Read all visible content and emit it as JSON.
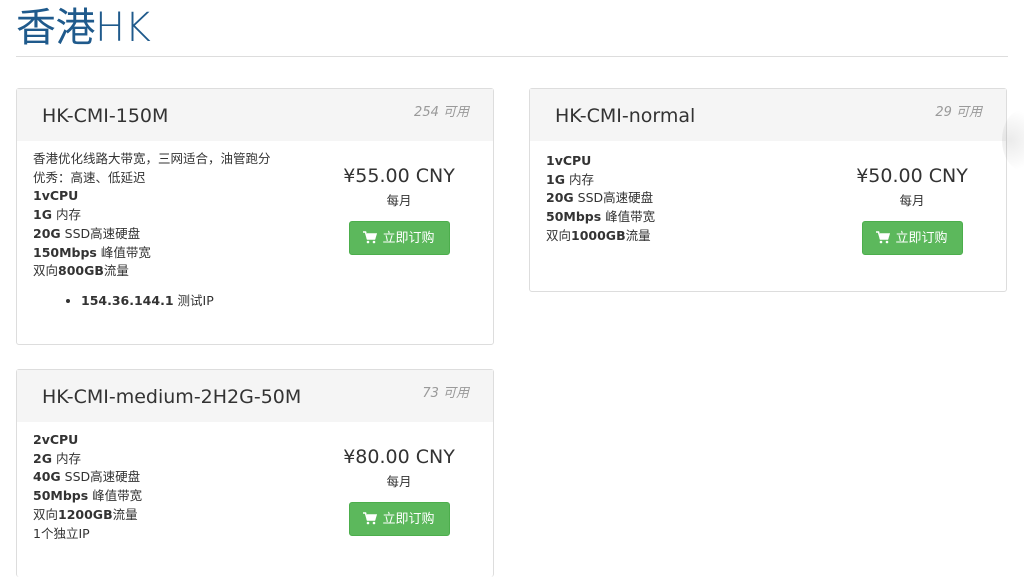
{
  "page_title": "香港HK",
  "products": [
    {
      "name": "HK-CMI-150M",
      "qty": "254 可用",
      "features": [
        {
          "bold": "",
          "text": "香港优化线路大带宽，三网适合，油管跑分"
        },
        {
          "bold": "",
          "text": "优秀：高速、低延迟"
        },
        {
          "bold": "1vCPU",
          "text": ""
        },
        {
          "bold": "1G",
          "text": " 内存"
        },
        {
          "bold": "20G",
          "text": " SSD高速硬盘"
        },
        {
          "bold": "150Mbps",
          "text": " 峰值带宽"
        },
        {
          "bold": "",
          "text": "双向",
          "bold2": "800GB",
          "text2": "流量"
        }
      ],
      "ip_list": [
        {
          "bold": "154.36.144.1",
          "text": " 测试IP"
        }
      ],
      "price": "¥55.00 CNY",
      "cycle": "每月",
      "order_label": "立即订购"
    },
    {
      "name": "HK-CMI-normal",
      "qty": "29 可用",
      "features": [
        {
          "bold": "1vCPU",
          "text": ""
        },
        {
          "bold": "1G",
          "text": " 内存"
        },
        {
          "bold": "20G",
          "text": " SSD高速硬盘"
        },
        {
          "bold": "50Mbps",
          "text": " 峰值带宽"
        },
        {
          "bold": "",
          "text": "双向",
          "bold2": "1000GB",
          "text2": "流量"
        }
      ],
      "price": "¥50.00 CNY",
      "cycle": "每月",
      "order_label": "立即订购"
    },
    {
      "name": "HK-CMI-medium-2H2G-50M",
      "qty": "73 可用",
      "features": [
        {
          "bold": "2vCPU",
          "text": ""
        },
        {
          "bold": "2G",
          "text": " 内存"
        },
        {
          "bold": "40G",
          "text": " SSD高速硬盘"
        },
        {
          "bold": "50Mbps",
          "text": " 峰值带宽"
        },
        {
          "bold": "",
          "text": "双向",
          "bold2": "1200GB",
          "text2": "流量"
        },
        {
          "bold": "",
          "text": "1个独立IP"
        }
      ],
      "price": "¥80.00 CNY",
      "cycle": "每月",
      "order_label": "立即订购"
    }
  ],
  "colors": {
    "accent": "#1f5a8c",
    "button": "#5cb85c"
  },
  "icons": {
    "order_button": "shopping-cart-icon"
  }
}
